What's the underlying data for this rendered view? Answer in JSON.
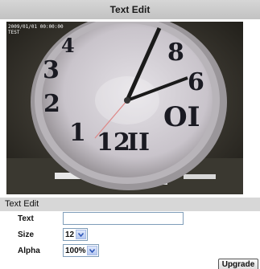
{
  "header": {
    "title": "Text Edit"
  },
  "video": {
    "overlay_text_line1": "2009/01/01 00:00:00",
    "overlay_text_line2": "TEST"
  },
  "text_edit": {
    "section_title": "Text Edit",
    "text_label": "Text",
    "text_value": "",
    "size_label": "Size",
    "size_value": "12",
    "alpha_label": "Alpha",
    "alpha_value": "100%"
  },
  "actions": {
    "upgrade_label": "Upgrade"
  },
  "colors": {
    "header_bg": "#c9c9c9",
    "section_bg": "#d7d7d7",
    "dropdown_accent": "#2f57b8"
  }
}
